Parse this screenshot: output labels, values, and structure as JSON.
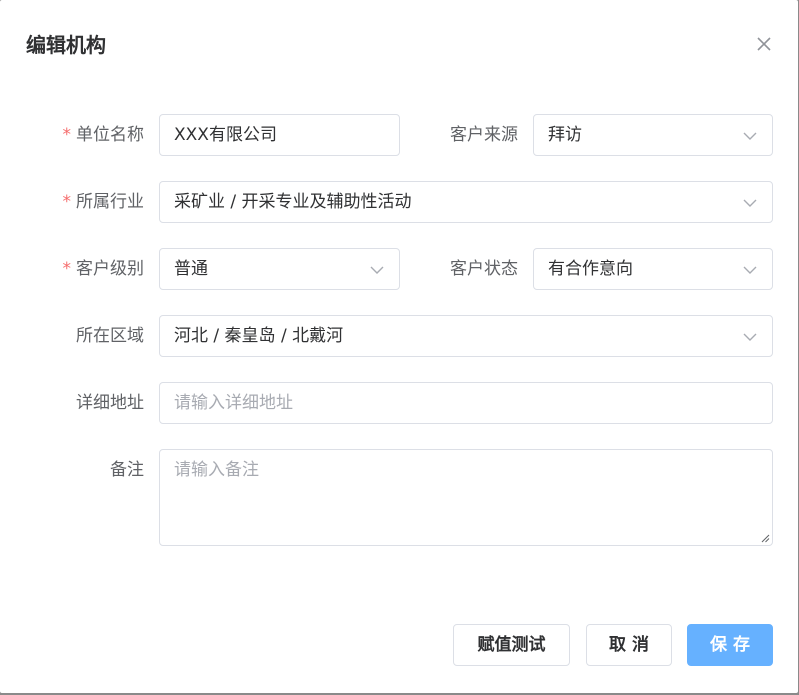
{
  "dialog": {
    "title": "编辑机构"
  },
  "form": {
    "unit_name": {
      "label": "单位名称",
      "required_mark": "*",
      "value": "XXX有限公司"
    },
    "customer_source": {
      "label": "客户来源",
      "value": "拜访"
    },
    "industry": {
      "label": "所属行业",
      "required_mark": "*",
      "value": "采矿业 / 开采专业及辅助性活动"
    },
    "customer_level": {
      "label": "客户级别",
      "required_mark": "*",
      "value": "普通"
    },
    "customer_status": {
      "label": "客户状态",
      "value": "有合作意向"
    },
    "region": {
      "label": "所在区域",
      "value": "河北 / 秦皇岛 / 北戴河"
    },
    "address": {
      "label": "详细地址",
      "placeholder": "请输入详细地址"
    },
    "remark": {
      "label": "备注",
      "placeholder": "请输入备注"
    }
  },
  "footer": {
    "test_label": "赋值测试",
    "cancel_label": "取消",
    "save_label": "保存"
  },
  "colors": {
    "required": "#f56c6c",
    "primary": "#66b1ff",
    "border": "#dcdfe6"
  }
}
